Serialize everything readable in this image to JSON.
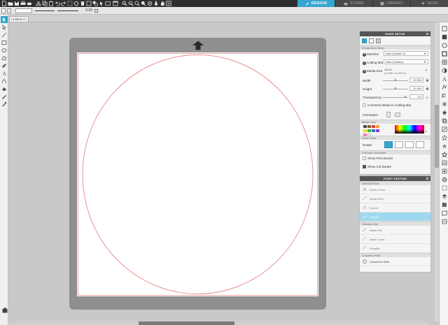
{
  "top_tabs": [
    {
      "label": "DESIGN",
      "icon": "design-icon",
      "active": true
    },
    {
      "label": "STORE",
      "icon": "store-icon",
      "active": false
    },
    {
      "label": "LIBRARY",
      "icon": "library-icon",
      "active": false
    },
    {
      "label": "SEND",
      "icon": "send-icon",
      "active": false
    }
  ],
  "options_bar": {
    "line_weight_value": "0.00"
  },
  "doc_tab": {
    "label": "Untitled-1",
    "close": "×"
  },
  "page_setup": {
    "title": "PAGE SETUP",
    "design_area_header": "Design Area Setup",
    "machine_label": "Machine",
    "machine_value": "Auto (Cameo 4)",
    "cutting_mat_label": "Cutting Mat",
    "cutting_mat_value": "Auto (Cameo)",
    "media_size_label": "Media Size",
    "media_size_value": "12x12",
    "media_size_sub": "(12.000 x 12.000 in)",
    "width_label": "Width",
    "width_value": "12.000",
    "height_label": "Height",
    "height_value": "12.000",
    "transparency_label": "Transparency",
    "transparency_value": "0.0",
    "constrain_label": "Constrain Media to Cutting Mat",
    "orientation_label": "Orientation",
    "media_color_header": "Media Color",
    "swatch_colors": [
      "#4a4a4a",
      "#8b5a2b",
      "#d94040",
      "#f0a030",
      "#e8e020",
      "#40b040",
      "#3070d0",
      "#9040c0",
      "#f080b0",
      "#ffffff"
    ],
    "power_view_header": "Power View",
    "rotate_label": "Rotate",
    "print_cut_header": "Print and Cut Border",
    "show_print_border_label": "Show Print Border",
    "show_cut_border_label": "Show Cut Border"
  },
  "point_editing": {
    "title": "POINT EDITING",
    "selected_point_header": "Selected Point",
    "delete_point": "Delete Point",
    "break_path": "Break Path",
    "corner": "Corner",
    "smooth": "Smooth",
    "selected_line_header": "Selected Line",
    "make_flat": "Make Flat",
    "make_curve": "Make Curve",
    "simplify": "Simplify",
    "convert_header": "Convert to Path",
    "convert_to_path": "Convert to Path"
  },
  "colors": {
    "accent": "#36a6d1",
    "cut_line": "#e06a6a",
    "mat": "#8f8f8f",
    "topbar": "#2e2e2e",
    "active_item": "#9fd9ef"
  }
}
